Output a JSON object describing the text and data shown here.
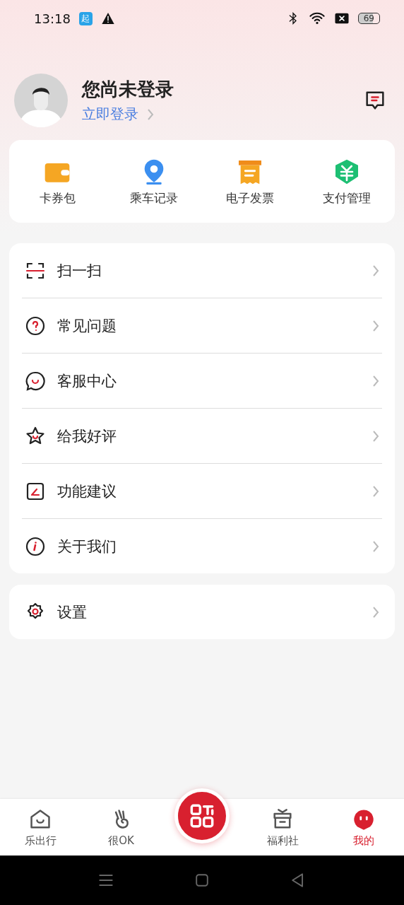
{
  "status_bar": {
    "time": "13:18",
    "app_badge": "起",
    "battery": "69"
  },
  "profile": {
    "title": "您尚未登录",
    "login_link": "立即登录"
  },
  "shortcuts": [
    {
      "kind": "wallet",
      "label": "卡券包"
    },
    {
      "kind": "location",
      "label": "乘车记录"
    },
    {
      "kind": "invoice",
      "label": "电子发票"
    },
    {
      "kind": "payment",
      "label": "支付管理"
    }
  ],
  "menu": [
    {
      "kind": "scan",
      "label": "扫一扫"
    },
    {
      "kind": "help",
      "label": "常见问题"
    },
    {
      "kind": "service",
      "label": "客服中心"
    },
    {
      "kind": "rate",
      "label": "给我好评"
    },
    {
      "kind": "feedback",
      "label": "功能建议"
    },
    {
      "kind": "about",
      "label": "关于我们"
    }
  ],
  "settings_menu": [
    {
      "kind": "settings",
      "label": "设置"
    }
  ],
  "tabs": [
    {
      "kind": "home",
      "label": "乐出行",
      "selected": false
    },
    {
      "kind": "ok",
      "label": "很OK",
      "selected": false
    },
    {
      "kind": "scan",
      "selected": false
    },
    {
      "kind": "gift",
      "label": "福利社",
      "selected": false
    },
    {
      "kind": "me",
      "label": "我的",
      "selected": true
    }
  ]
}
